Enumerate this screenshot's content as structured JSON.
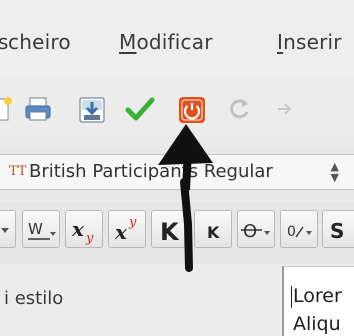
{
  "menubar": {
    "items": [
      {
        "text": "s",
        "mnemonic": "",
        "rest": ""
      },
      {
        "text": "",
        "mnemonic": "",
        "rest": "cheiro"
      },
      {
        "text": "",
        "mnemonic": "M",
        "rest": "odificar"
      },
      {
        "text": "",
        "mnemonic": "I",
        "rest": "nserir"
      }
    ]
  },
  "toolbar": {
    "icons": [
      "new-document-icon",
      "print-icon",
      "save-download-icon",
      "green-checkmark-icon",
      "power-stop-icon",
      "reload-icon",
      "arrow-icon"
    ]
  },
  "font": {
    "icon_text": "TT",
    "value": "British Participants Regular"
  },
  "format_buttons": [
    "underline-dropdown-icon",
    "wave-underline-icon",
    "subscript-icon",
    "superscript-icon",
    "kerning-k-icon",
    "small-k-icon",
    "strikethrough-icon",
    "numbering-icon",
    "s-icon"
  ],
  "style_pane": {
    "label": "i estilo"
  },
  "document": {
    "line1": "Lorer",
    "line2": "Aliqu"
  },
  "colors": {
    "check_green": "#34b233",
    "stop_orange": "#e0501c",
    "arrow_black": "#111111"
  }
}
